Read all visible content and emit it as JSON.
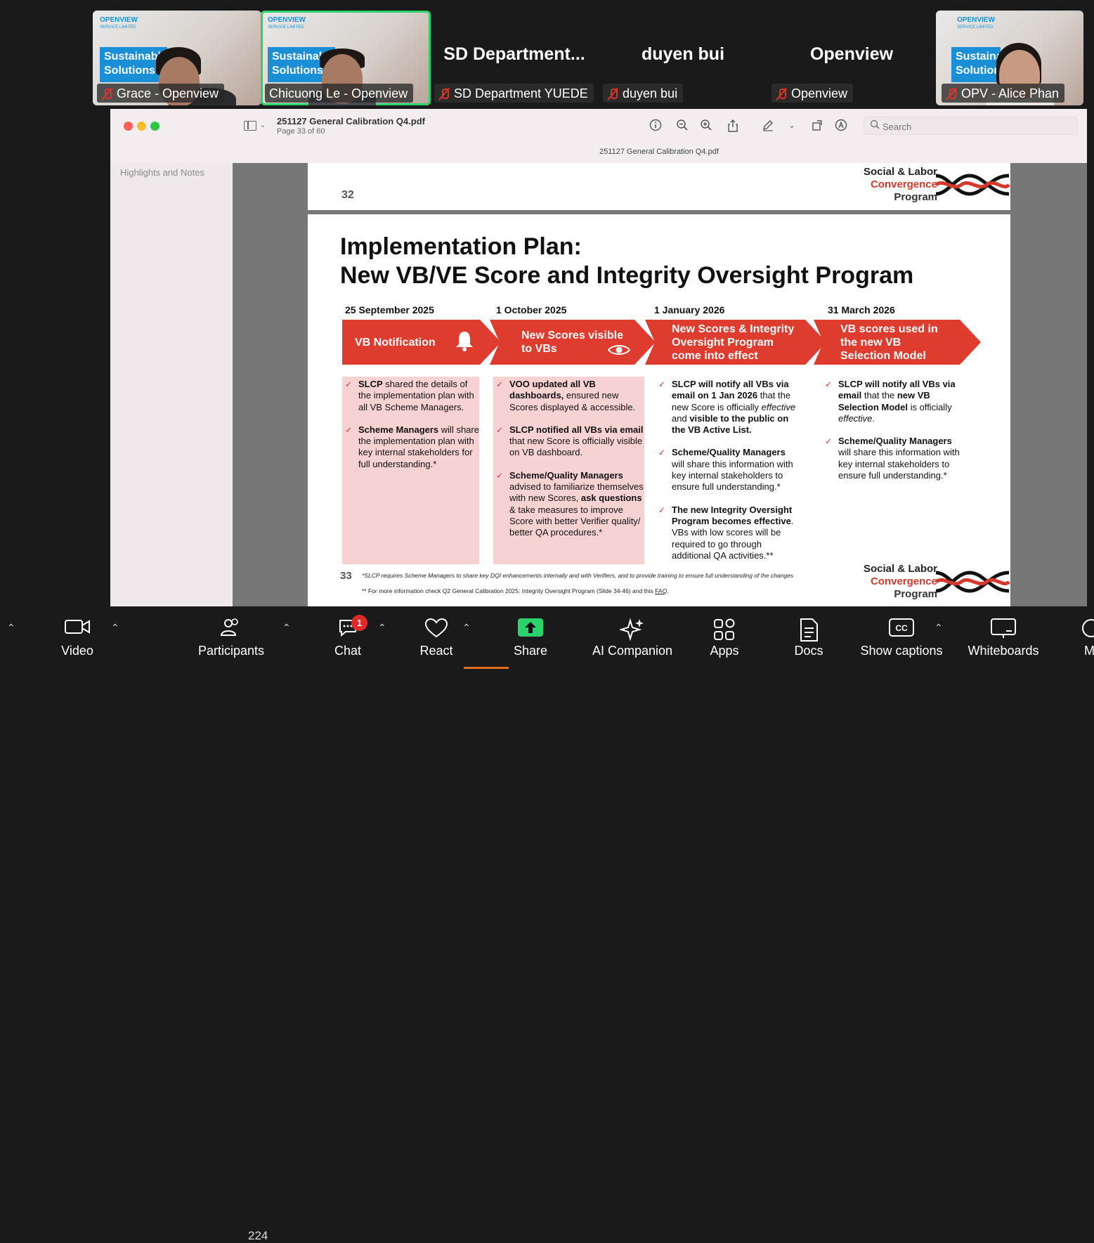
{
  "gallery": {
    "participants": [
      {
        "name": "Grace - Openview",
        "brand": "OPENVIEW",
        "brand_sub": "SERVICE LIMITED",
        "bg_text": "Sustainable Solutions"
      },
      {
        "name": "Chicuong Le - Openview",
        "brand": "OPENVIEW",
        "brand_sub": "SERVICE LIMITED",
        "bg_text": "Sustainable Solutions"
      },
      {
        "name": "SD Department YUEDE",
        "display": "SD  Department..."
      },
      {
        "name": "duyen bui",
        "display": "duyen bui"
      },
      {
        "name": "Openview",
        "display": "Openview"
      },
      {
        "name": "OPV - Alice Phan",
        "brand": "OPENVIEW",
        "brand_sub": "SERVICE LIMITED",
        "bg_text": "Sustainable Solutions"
      }
    ]
  },
  "pdf": {
    "filename": "251127 General Calibration Q4.pdf",
    "page_indicator": "Page 33 of 60",
    "window_title": "251127 General Calibration Q4.pdf",
    "search_placeholder": "Search",
    "sidebar_label": "Highlights and Notes"
  },
  "slide32": {
    "page_number": "32"
  },
  "logo": {
    "line1": "Social & Labor",
    "line2": "Convergence",
    "line3": "Program"
  },
  "slide33": {
    "title_line1": "Implementation Plan:",
    "title_line2": "New VB/VE Score and Integrity Oversight Program",
    "phases": [
      {
        "date": "25 September 2025",
        "label": "VB Notification"
      },
      {
        "date": "1 October 2025",
        "label": "New Scores visible to VBs"
      },
      {
        "date": "1 January 2026",
        "label": "New Scores & Integrity Oversight Program come into effect"
      },
      {
        "date": "31 March 2026",
        "label": "VB scores used in the new VB Selection Model"
      }
    ],
    "col1": {
      "b1_bold": "SLCP",
      "b1_rest": " shared the details of the implementation plan with all VB Scheme Managers.",
      "b2_bold": "Scheme Managers",
      "b2_rest": " will share the implementation plan with key internal stakeholders for full understanding.*"
    },
    "col2": {
      "b1_bold": "VOO updated all VB dashboards,",
      "b1_rest": " ensured new Scores displayed & accessible.",
      "b2_bold1": "SLCP notified all VBs via email",
      "b2_rest": " that new Score is officially visible on VB dashboard.",
      "b3_bold1": "Scheme/Quality Managers",
      "b3_mid": " advised to familiarize themselves with new Scores, ",
      "b3_bold2": "ask questions",
      "b3_rest": " & take measures to improve Score with better Verifier quality/ better QA procedures.*"
    },
    "col3": {
      "b1_bold1": "SLCP will notify all VBs via email on 1 Jan 2026",
      "b1_mid1": " that the new Score is officially ",
      "b1_ital": "effective",
      "b1_mid2": " and ",
      "b1_bold2": "visible to the public on the VB Active List.",
      "b2_bold": "Scheme/Quality Managers",
      "b2_rest": " will share this information with key internal stakeholders to ensure full understanding.*",
      "b3_bold": "The new Integrity Oversight Program becomes effective",
      "b3_rest": ". VBs with low scores will be required to go through additional QA activities.**"
    },
    "col4": {
      "b1_bold1": "SLCP will notify all VBs via email",
      "b1_mid": " that the ",
      "b1_bold2": "new VB Selection Model",
      "b1_mid2": " is officially ",
      "b1_ital": "effective",
      "b1_end": ".",
      "b2_bold": "Scheme/Quality Managers",
      "b2_rest": " will share this information with key internal stakeholders to ensure full understanding.*"
    },
    "page_number": "33",
    "footnote1": "*SLCP requires Scheme Managers to share key DQI enhancements internally and with Verifiers, and to provide training to ensure full understanding of the changes",
    "footnote2_pre": "** For more information check Q2 General Calibration 2025: Integrity Oversight Program (Slide 34-46) and this ",
    "footnote2_link": "FAQ",
    "footnote2_end": "."
  },
  "toolbar": {
    "video": "Video",
    "participants": "Participants",
    "participant_count": "224",
    "chat": "Chat",
    "chat_badge": "1",
    "react": "React",
    "share": "Share",
    "ai": "AI Companion",
    "apps": "Apps",
    "docs": "Docs",
    "captions": "Show captions",
    "whiteboards": "Whiteboards",
    "more": "M"
  },
  "colors": {
    "accent_red": "#de3c2f",
    "share_green": "#2bd16b",
    "active_speaker": "#2bd16b",
    "pink_panel": "#f6d3d2"
  }
}
